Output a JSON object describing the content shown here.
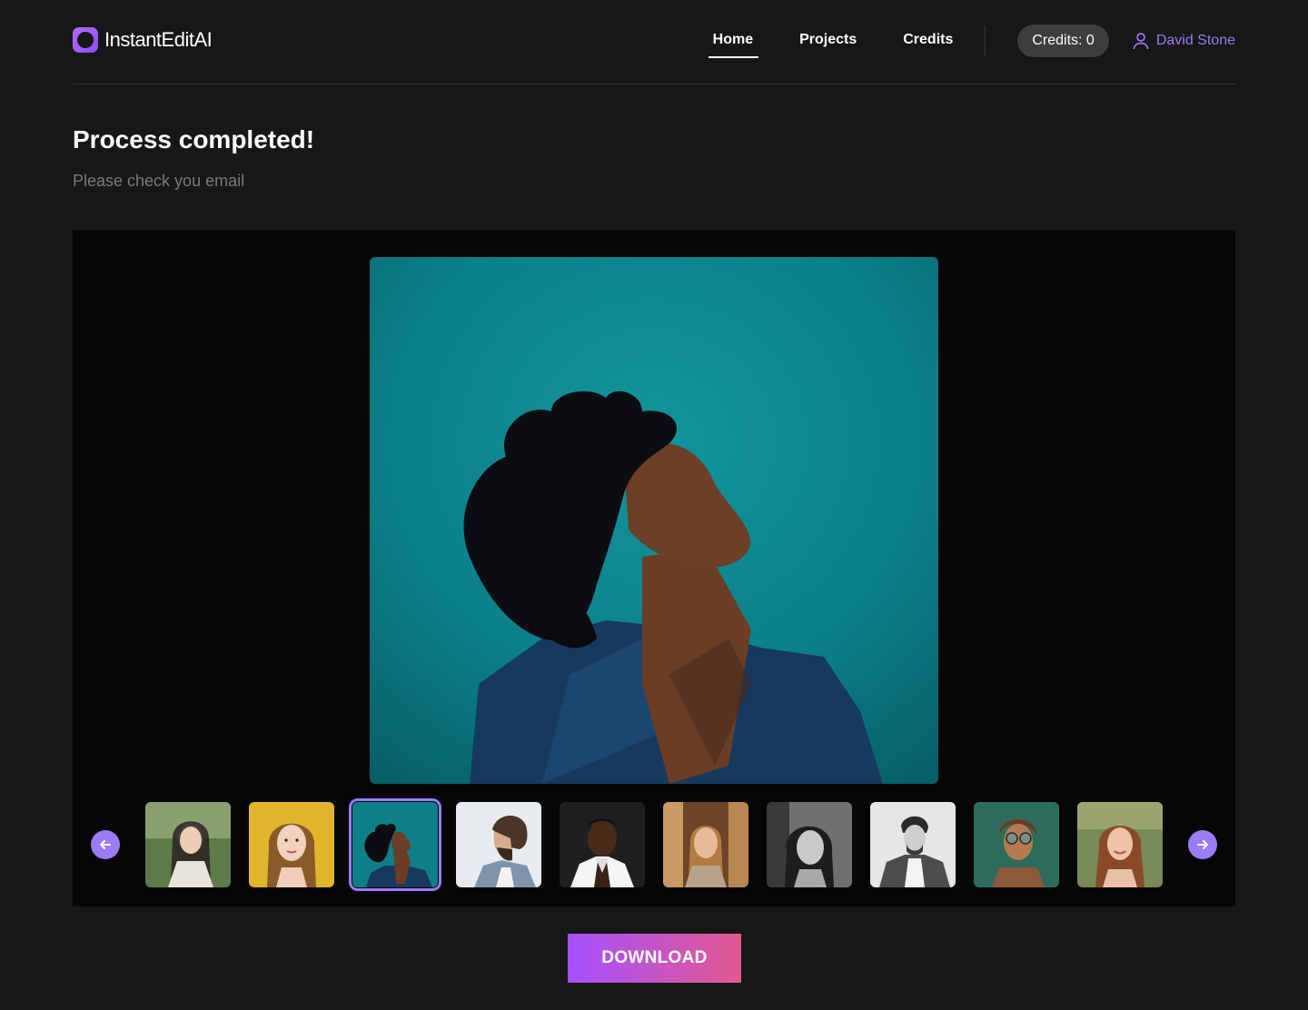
{
  "app": {
    "name": "InstantEditAI"
  },
  "nav": {
    "links": [
      {
        "label": "Home",
        "active": true
      },
      {
        "label": "Projects",
        "active": false
      },
      {
        "label": "Credits",
        "active": false
      }
    ],
    "credits_label": "Credits: 0",
    "user_name": "David Stone",
    "user_icon": "user-icon"
  },
  "page": {
    "title": "Process completed!",
    "subtitle": "Please check you email"
  },
  "gallery": {
    "selected_index": 2,
    "prev_icon": "arrow-left-icon",
    "next_icon": "arrow-right-icon",
    "thumbnails": [
      {
        "id": "woman-long-hair-park",
        "bg": "#5e7a4a"
      },
      {
        "id": "woman-yellow-background",
        "bg": "#e0b52c"
      },
      {
        "id": "woman-looking-up-teal",
        "bg": "#0f7f88"
      },
      {
        "id": "man-beard-profile",
        "bg": "#e9ecef"
      },
      {
        "id": "man-dark-portrait",
        "bg": "#1f1f1f"
      },
      {
        "id": "woman-warm-light",
        "bg": "#6e4528"
      },
      {
        "id": "woman-black-white",
        "bg": "#6f6f6f"
      },
      {
        "id": "man-denim-jacket-bw",
        "bg": "#e6e6e6"
      },
      {
        "id": "man-sunglasses-green",
        "bg": "#2f6b5b"
      },
      {
        "id": "woman-smiling-outdoor",
        "bg": "#7a8a56"
      }
    ]
  },
  "actions": {
    "download_label": "DOWNLOAD"
  },
  "colors": {
    "background": "#171717",
    "accent": "#9b7cf5",
    "gradient_start": "#a550ff",
    "gradient_end": "#e3598f"
  }
}
